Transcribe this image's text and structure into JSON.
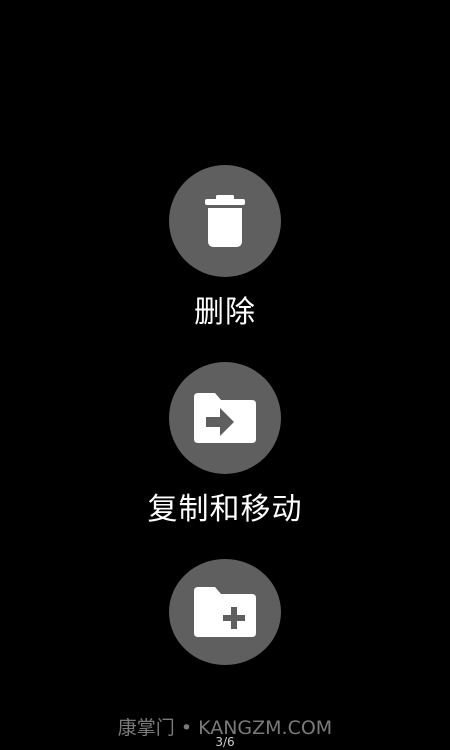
{
  "actions": {
    "delete": {
      "label": "删除",
      "icon": "trash-icon"
    },
    "move": {
      "label": "复制和移动",
      "icon": "folder-move-icon"
    },
    "new_folder": {
      "label": "",
      "icon": "folder-plus-icon"
    }
  },
  "watermark": "康掌门 • KANGZM.COM",
  "pager": "3/6",
  "colors": {
    "background": "#000000",
    "button": "#5f5f5f",
    "icon": "#ffffff",
    "label": "#ffffff"
  }
}
